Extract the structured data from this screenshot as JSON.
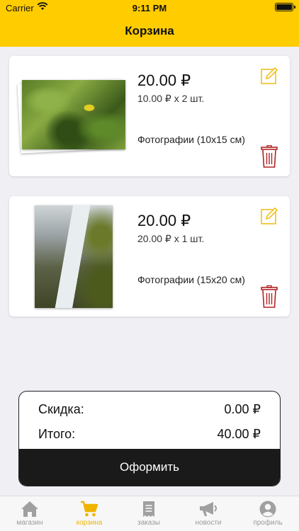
{
  "status_bar": {
    "carrier": "Carrier",
    "time": "9:11 PM"
  },
  "header": {
    "title": "Корзина"
  },
  "cart_items": [
    {
      "price": "20.00 ₽",
      "quantity": "10.00 ₽ x 2 шт.",
      "product": "Фотографии (10x15 см)"
    },
    {
      "price": "20.00 ₽",
      "quantity": "20.00 ₽ x 1 шт.",
      "product": "Фотографии (15x20 см)"
    }
  ],
  "summary": {
    "discount_label": "Скидка:",
    "discount_value": "0.00 ₽",
    "total_label": "Итого:",
    "total_value": "40.00 ₽",
    "checkout_label": "Оформить"
  },
  "tabs": [
    {
      "label": "магазин",
      "icon": "home-icon"
    },
    {
      "label": "корзина",
      "icon": "cart-icon"
    },
    {
      "label": "заказы",
      "icon": "orders-icon"
    },
    {
      "label": "новости",
      "icon": "megaphone-icon"
    },
    {
      "label": "профиль",
      "icon": "profile-icon"
    }
  ],
  "colors": {
    "accent": "#ffcc00",
    "active_tab": "#f0b400",
    "delete": "#b22222",
    "checkout_bg": "#1a1a1a"
  }
}
